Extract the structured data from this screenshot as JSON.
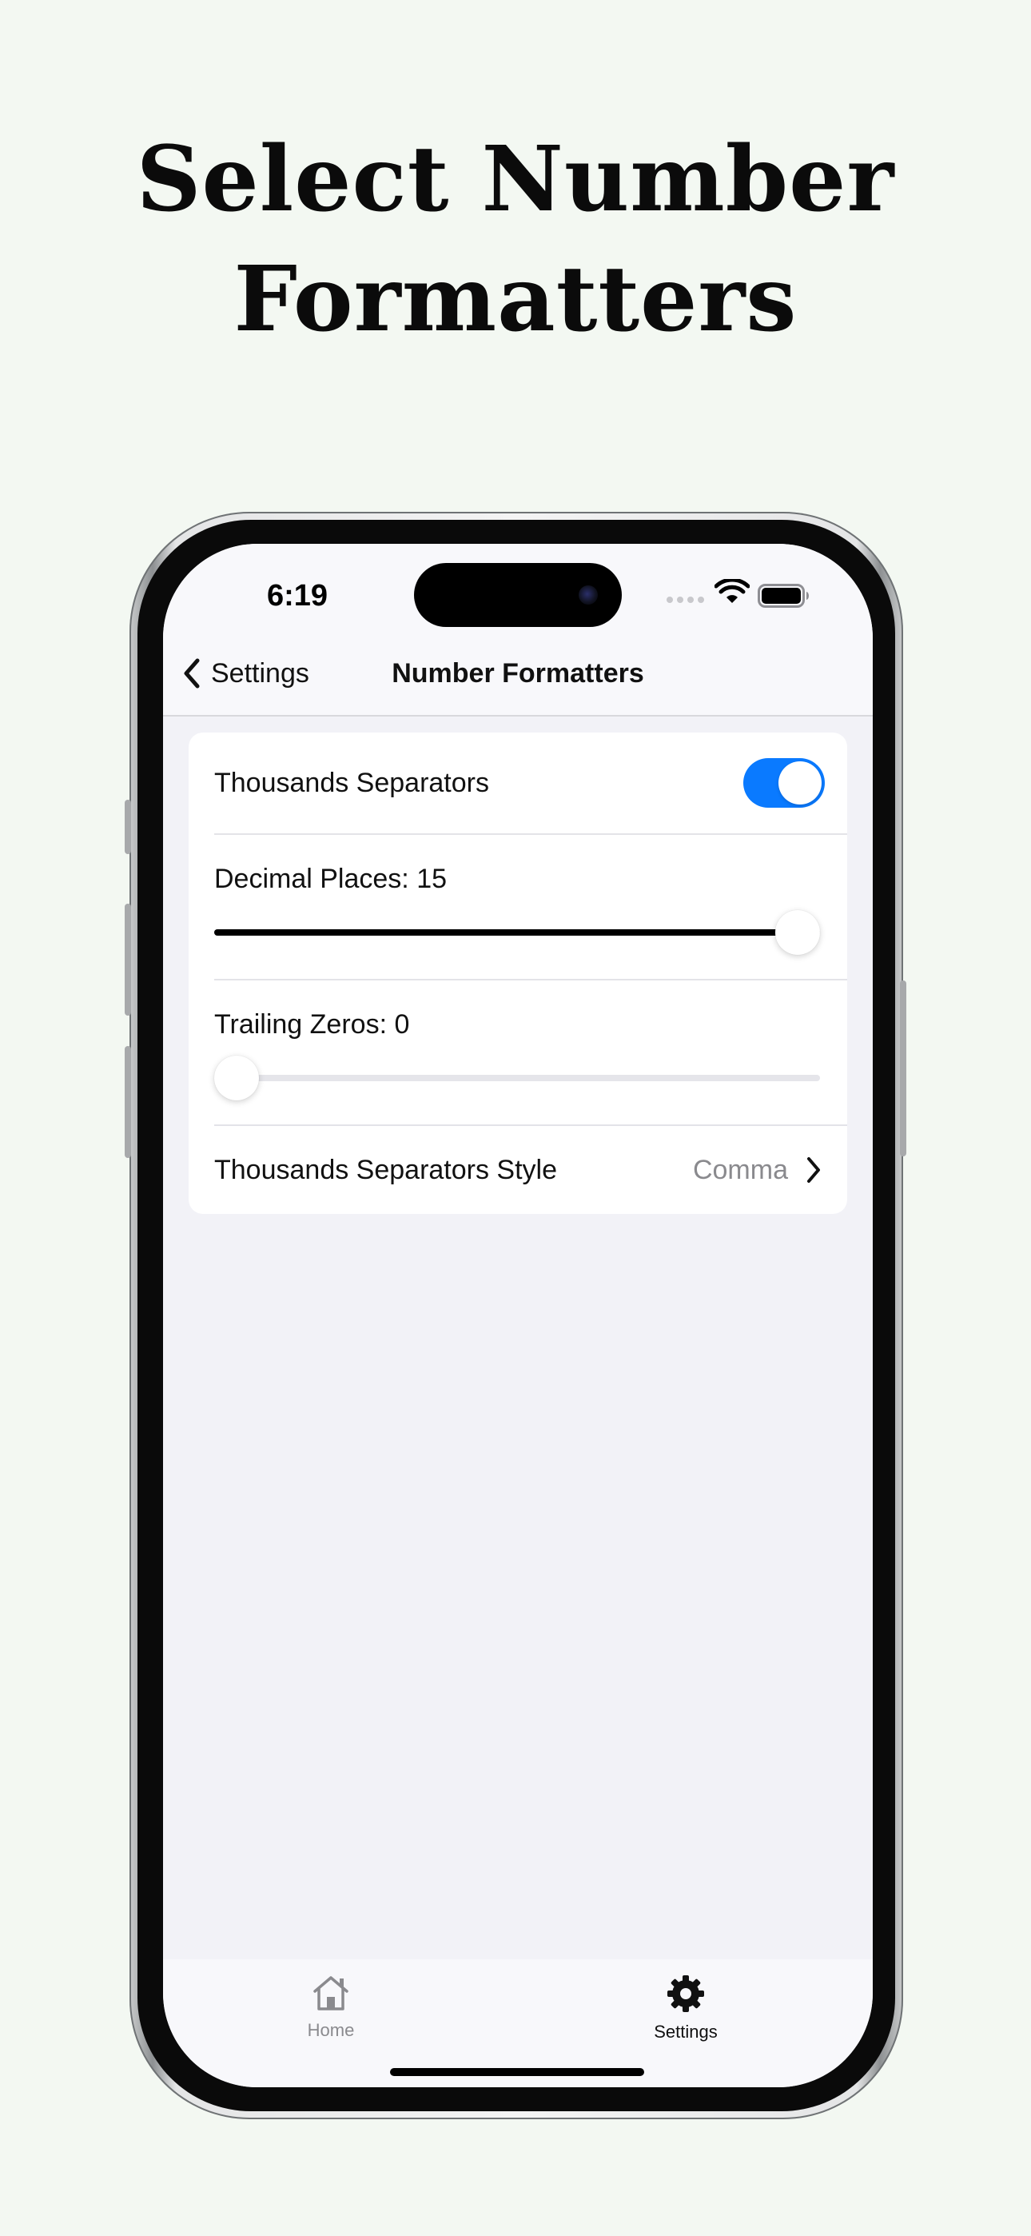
{
  "headline": {
    "line1": "Select Number",
    "line2": "Formatters"
  },
  "status_bar": {
    "time": "6:19"
  },
  "nav": {
    "back_label": "Settings",
    "title": "Number Formatters"
  },
  "settings": {
    "thousands_separators": {
      "label": "Thousands Separators",
      "enabled": true
    },
    "decimal_places": {
      "label": "Decimal Places: 15",
      "value": 15,
      "max": 15
    },
    "trailing_zeros": {
      "label": "Trailing Zeros: 0",
      "value": 0,
      "max": 15
    },
    "separator_style": {
      "label": "Thousands Separators Style",
      "value": "Comma"
    }
  },
  "tab_bar": {
    "home_label": "Home",
    "settings_label": "Settings",
    "selected": "Settings"
  },
  "colors": {
    "accent": "#0a7aff",
    "page_background": "#f3f8f2",
    "screen_background": "#f2f2f7",
    "secondary_text": "#8a8a8e"
  },
  "icons": {
    "back": "chevron-left-icon",
    "disclosure": "chevron-right-icon",
    "home_tab": "house-icon",
    "settings_tab": "gear-icon",
    "wifi": "wifi-icon",
    "battery": "battery-icon"
  }
}
